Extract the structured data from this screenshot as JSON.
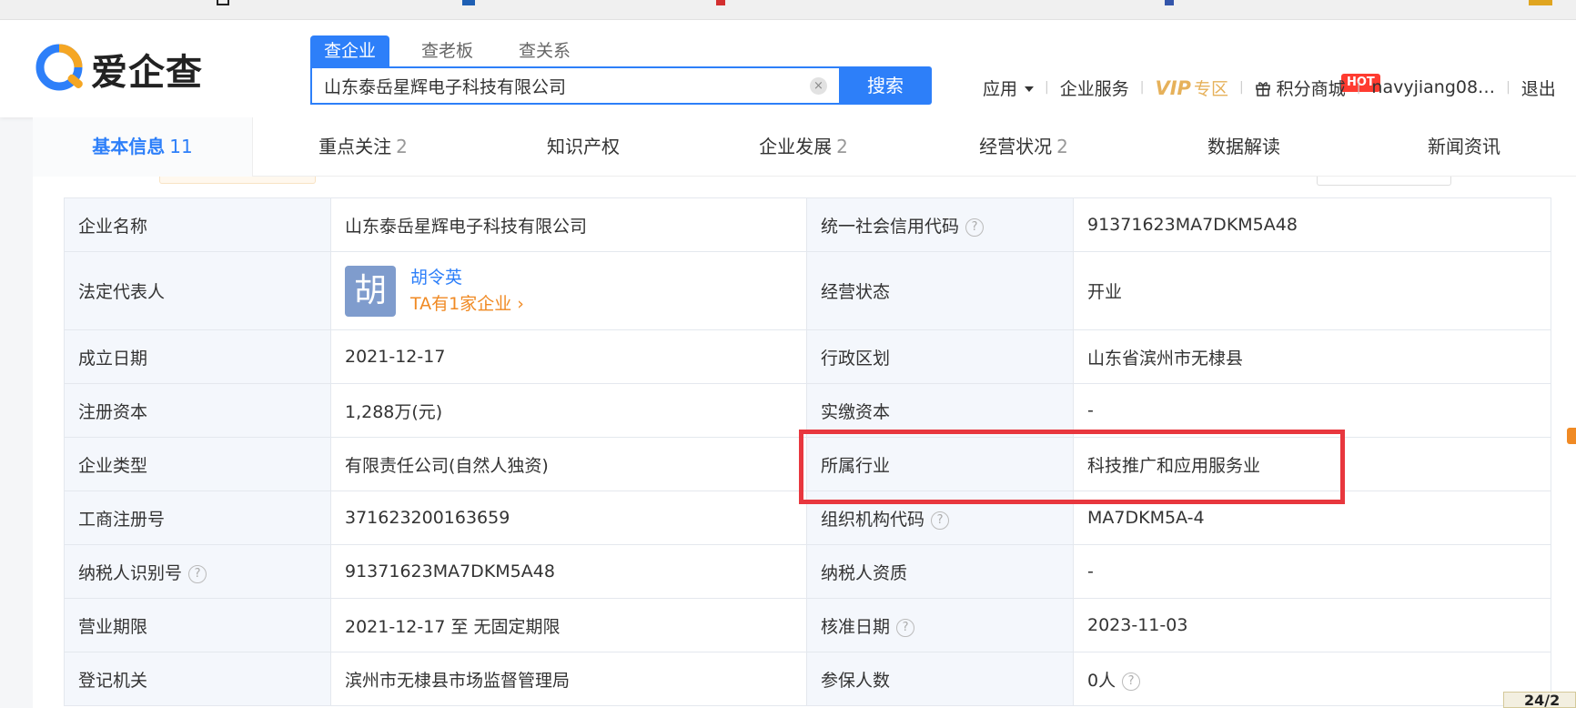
{
  "search": {
    "tabs": [
      "查企业",
      "查老板",
      "查关系"
    ],
    "query": "山东泰岳星辉电子科技有限公司",
    "button_label": "搜索"
  },
  "logo": {
    "text": "爱企查"
  },
  "topnav": {
    "apps": "应用",
    "enterprise_service": "企业服务",
    "vip_word": "VIP",
    "vip_zone": "专区",
    "points_mall": "积分商城",
    "hot_badge": "HOT",
    "username": "navyjiang08…",
    "logout": "退出"
  },
  "tabs": [
    {
      "label": "基本信息",
      "count": "11"
    },
    {
      "label": "重点关注",
      "count": "2"
    },
    {
      "label": "知识产权",
      "count": ""
    },
    {
      "label": "企业发展",
      "count": "2"
    },
    {
      "label": "经营状况",
      "count": "2"
    },
    {
      "label": "数据解读",
      "count": ""
    },
    {
      "label": "新闻资讯",
      "count": ""
    }
  ],
  "info": {
    "company_name_label": "企业名称",
    "company_name": "山东泰岳星辉电子科技有限公司",
    "credit_code_label": "统一社会信用代码",
    "credit_code": "91371623MA7DKM5A48",
    "legal_rep_label": "法定代表人",
    "legal_rep_avatar": "胡",
    "legal_rep_name": "胡令英",
    "legal_rep_link": "TA有1家企业",
    "status_label": "经营状态",
    "status": "开业",
    "founded_label": "成立日期",
    "founded": "2021-12-17",
    "region_label": "行政区划",
    "region": "山东省滨州市无棣县",
    "reg_capital_label": "注册资本",
    "reg_capital": "1,288万(元)",
    "paid_capital_label": "实缴资本",
    "paid_capital": "-",
    "type_label": "企业类型",
    "type": "有限责任公司(自然人独资)",
    "industry_label": "所属行业",
    "industry": "科技推广和应用服务业",
    "reg_no_label": "工商注册号",
    "reg_no": "371623200163659",
    "org_code_label": "组织机构代码",
    "org_code": "MA7DKM5A-4",
    "taxpayer_id_label": "纳税人识别号",
    "taxpayer_id": "91371623MA7DKM5A48",
    "taxpayer_qual_label": "纳税人资质",
    "taxpayer_qual": "-",
    "term_label": "营业期限",
    "term": "2021-12-17 至 无固定期限",
    "approval_date_label": "核准日期",
    "approval_date": "2023-11-03",
    "authority_label": "登记机关",
    "authority": "滨州市无棣县市场监督管理局",
    "insured_label": "参保人数",
    "insured": "0人"
  },
  "help_glyph": "?",
  "clear_glyph": "×",
  "link_glyph": "›",
  "page_badge": "24/2",
  "colors": {
    "brand_blue": "#2d7ff9",
    "accent_orange": "#f08a24",
    "highlight_red": "#e8373e",
    "vip_gold": "#e6b15a"
  }
}
